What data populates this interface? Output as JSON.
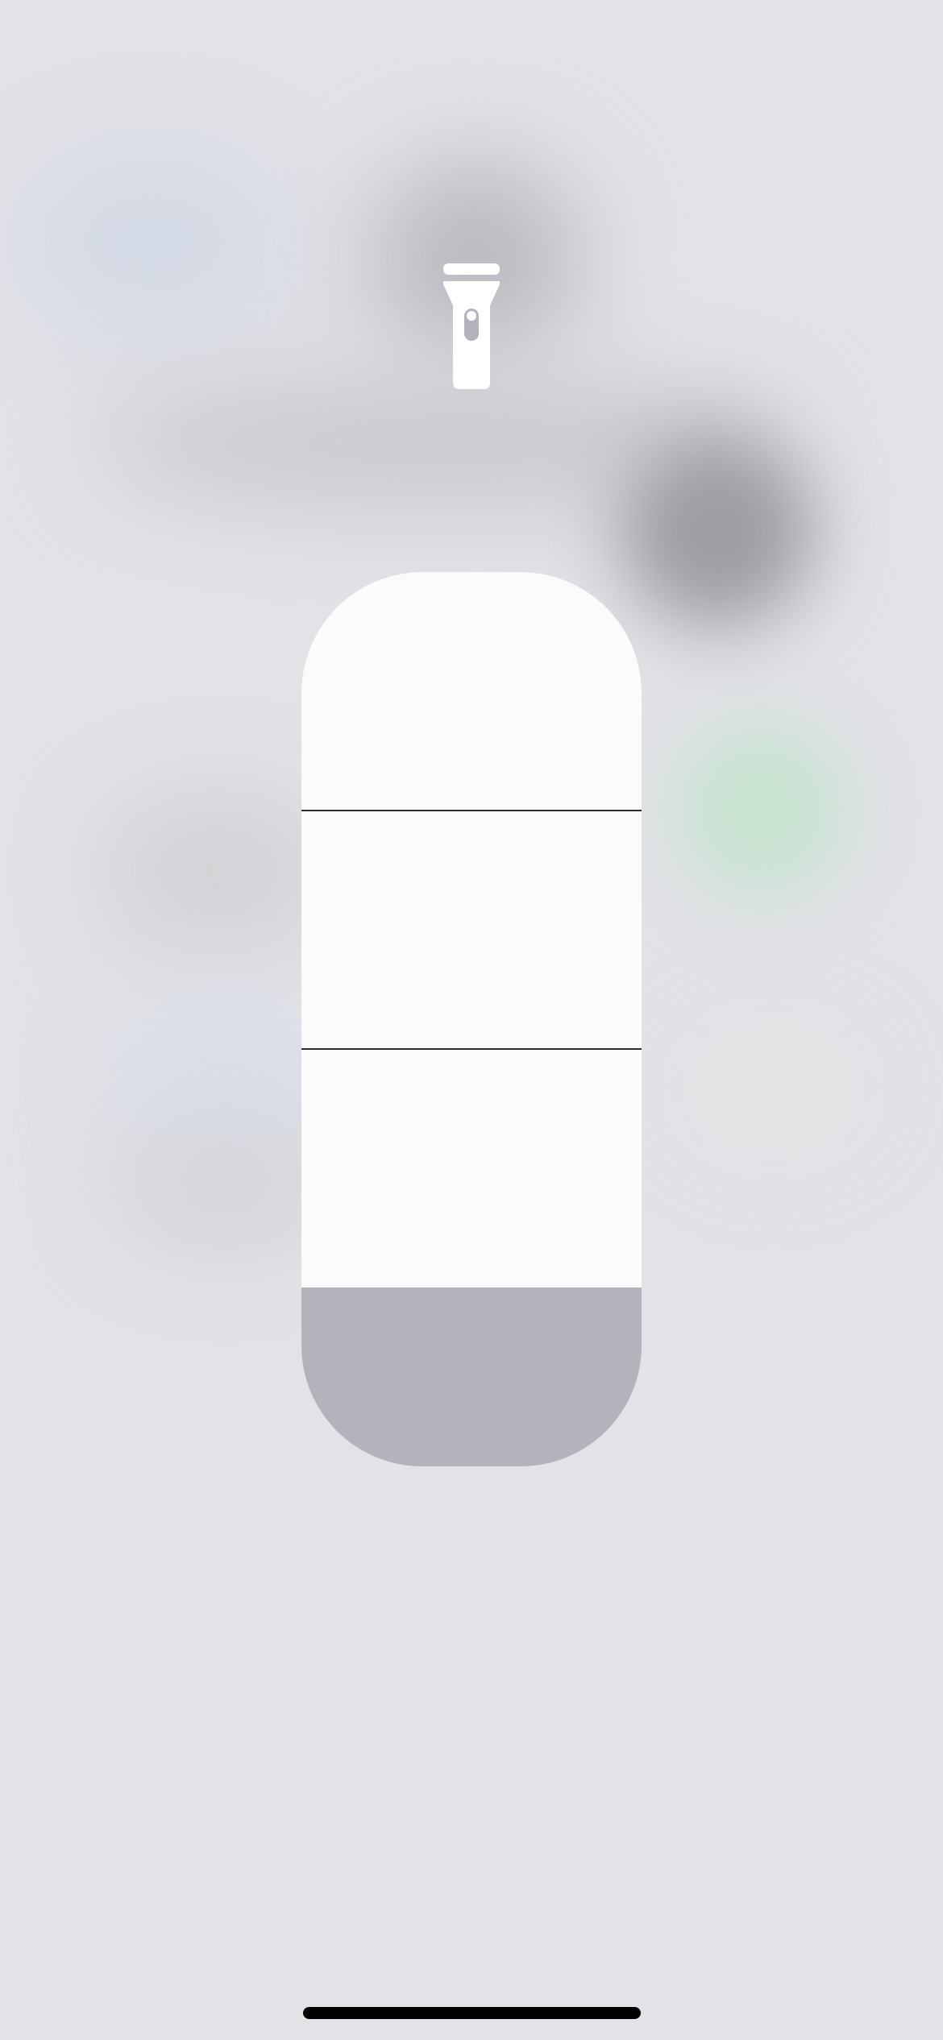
{
  "control": {
    "name": "flashlight",
    "icon": "flashlight-icon",
    "brightness_levels": 4,
    "selected_level": 3,
    "brightness_fraction": 0.8
  },
  "colors": {
    "background": "#e2e2e7",
    "slider_track": "#b3b3bb",
    "slider_fill": "#fbfbfb",
    "icon": "#ffffff",
    "divider": "#2c2c2e"
  }
}
